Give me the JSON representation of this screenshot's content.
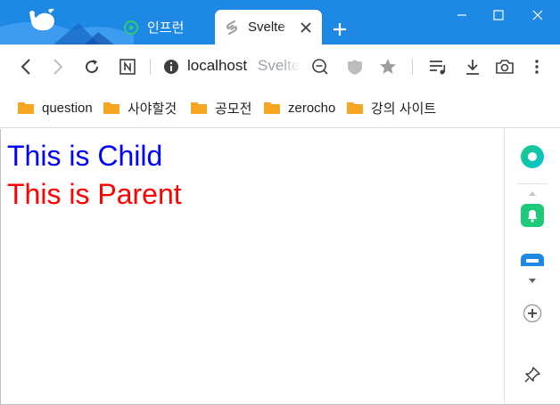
{
  "tabs": [
    {
      "title": "인프런",
      "active": false,
      "icon": "inflearn-leaf-icon"
    },
    {
      "title": "Svelte",
      "active": true,
      "icon": "svelte-icon"
    }
  ],
  "toolbar": {
    "host": "localhost",
    "path": "Svelte"
  },
  "bookmarks": [
    {
      "label": "question"
    },
    {
      "label": "사야할것"
    },
    {
      "label": "공모전"
    },
    {
      "label": "zerocho"
    },
    {
      "label": "강의 사이트"
    }
  ],
  "page": {
    "child_text": "This is Child",
    "parent_text": "This is Parent"
  },
  "colors": {
    "tab_strip": "#1e88e5",
    "child_text": "#0000ff",
    "parent_text": "#ff0000",
    "folder": "#f5a623",
    "sidebar_green": "#1ec97a"
  }
}
